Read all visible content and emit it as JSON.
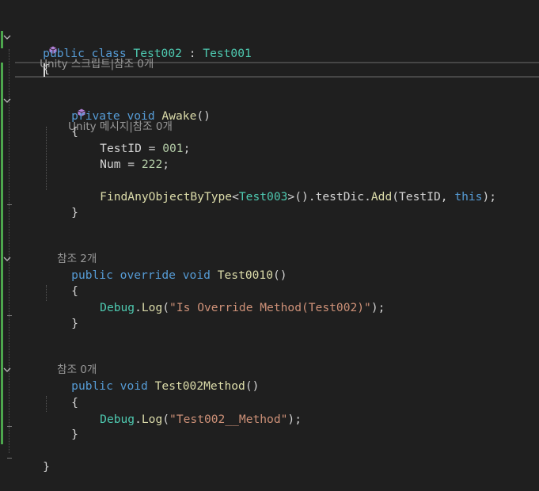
{
  "colors": {
    "background": "#1f1f1f",
    "keyword": "#569cd6",
    "type": "#4ec9b0",
    "method": "#dcdcaa",
    "number": "#b5cea8",
    "string": "#ce9178",
    "plain": "#d4d4d4",
    "codelens": "#999999",
    "changed_bar": "#4da64d",
    "unity_icon": "#b180d7"
  },
  "codelens": {
    "class_lens": "Unity 스크립트|참조 0개",
    "awake_lens": "Unity 메시지|참조 0개",
    "override_lens": "참조 2개",
    "method_lens": "참조 0개"
  },
  "code": {
    "class_public": "public",
    "class_kw": "class",
    "class_name": "Test002",
    "class_colon": " : ",
    "base_name": "Test001",
    "open_brace": "{",
    "close_brace": "}",
    "awake_private": "private",
    "awake_void": "void",
    "awake_name": "Awake",
    "awake_parens": "()",
    "awake_open": "{",
    "testid_var": "TestID",
    "testid_eq": " = ",
    "testid_val": "001",
    "testid_semi": ";",
    "num_var": "Num",
    "num_eq": " = ",
    "num_val": "222",
    "num_semi": ";",
    "find_method": "FindAnyObjectByType",
    "find_lt": "<",
    "find_type": "Test003",
    "find_rest1": ">().",
    "find_field": "testDic",
    "find_dot": ".",
    "find_add": "Add",
    "find_args1": "(TestID, ",
    "find_this": "this",
    "find_end": ");",
    "awake_close": "}",
    "ov_public": "public",
    "ov_override": "override",
    "ov_void": "void",
    "ov_name": "Test0010",
    "ov_parens": "()",
    "ov_open": "{",
    "ov_debug": "Debug",
    "ov_dot": ".",
    "ov_log": "Log",
    "ov_lparen": "(",
    "ov_string": "\"Is Override Method(Test002)\"",
    "ov_end": ");",
    "ov_close": "}",
    "m_public": "public",
    "m_void": "void",
    "m_name": "Test002Method",
    "m_parens": "()",
    "m_open": "{",
    "m_debug": "Debug",
    "m_dot": ".",
    "m_log": "Log",
    "m_lparen": "(",
    "m_string": "\"Test002__Method\"",
    "m_end": ");",
    "m_close": "}"
  }
}
